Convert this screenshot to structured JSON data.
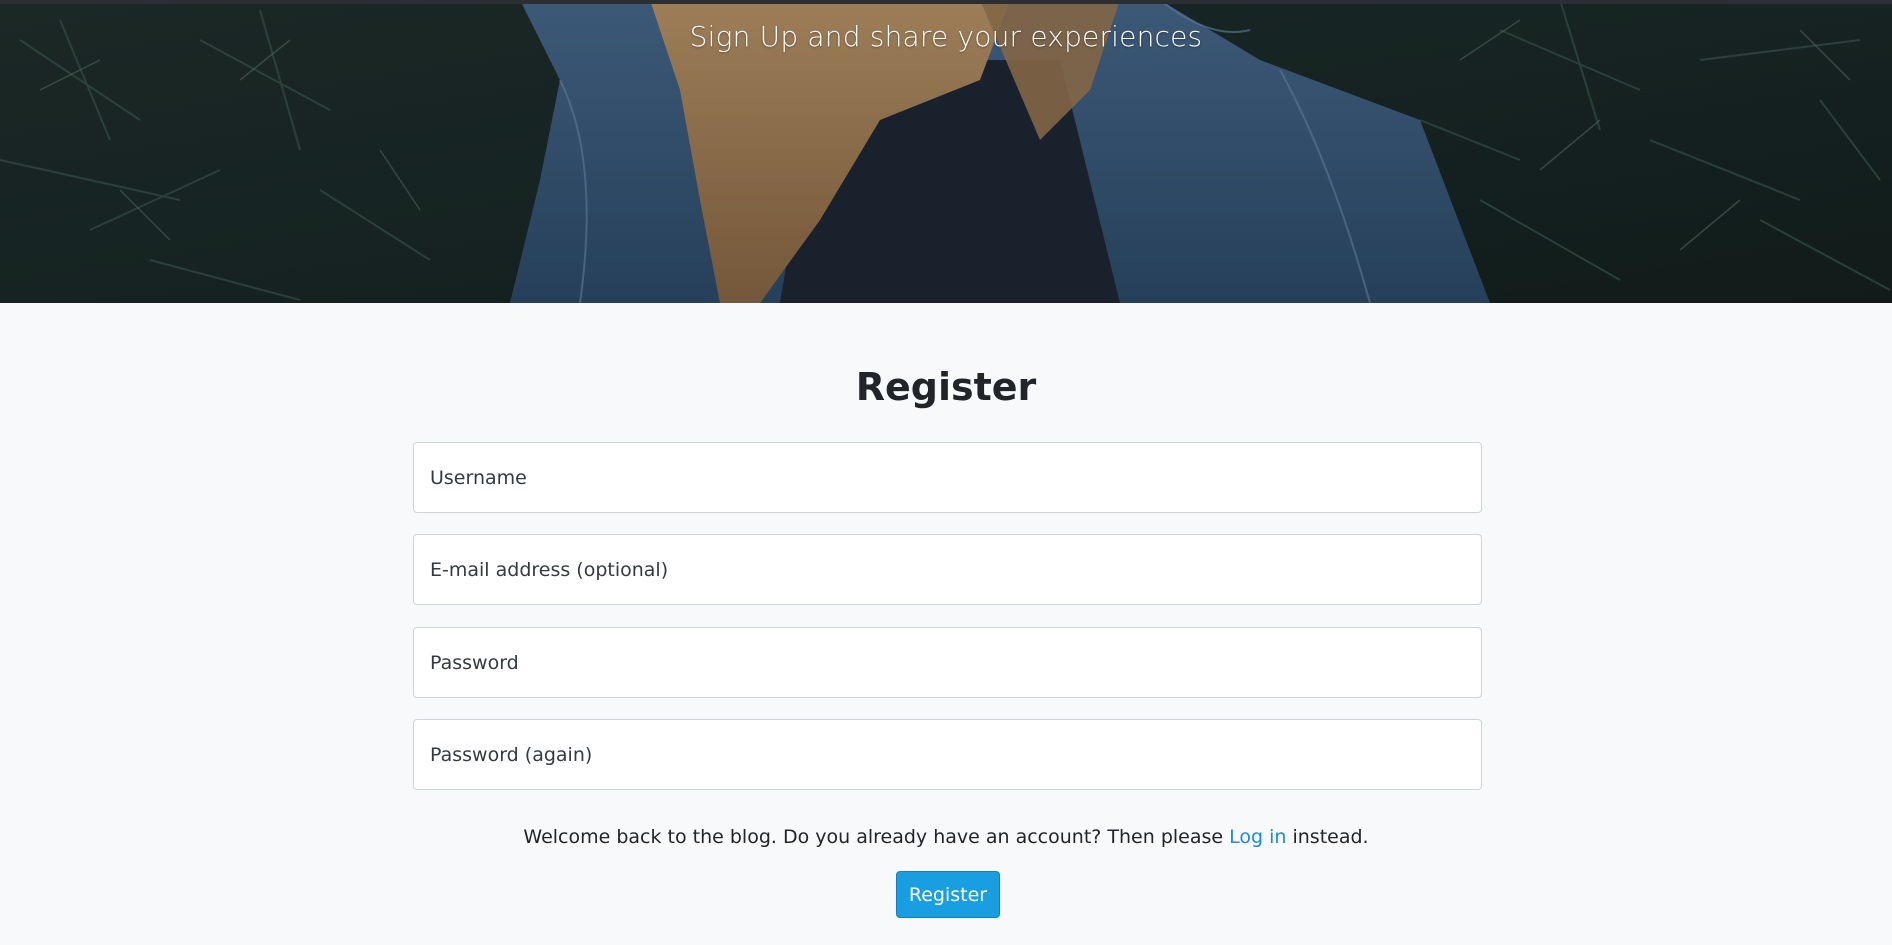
{
  "hero": {
    "tagline": "Sign Up and share your experiences"
  },
  "form": {
    "title": "Register",
    "fields": [
      {
        "name": "username",
        "placeholder": "Username"
      },
      {
        "name": "email",
        "placeholder": "E-mail address (optional)"
      },
      {
        "name": "password",
        "placeholder": "Password"
      },
      {
        "name": "password_again",
        "placeholder": "Password (again)"
      }
    ],
    "notice": {
      "before": "Welcome back to the blog. Do you already have an account? Then please ",
      "link": "Log in",
      "after": " instead."
    },
    "submit_label": "Register"
  },
  "colors": {
    "accent": "#1a9ee2",
    "link": "#1a8cd8",
    "background": "#f8f9fa",
    "hero_foliage": "#1c2c2b",
    "denim": "#3e5f82",
    "hair": "#b08a5e"
  }
}
